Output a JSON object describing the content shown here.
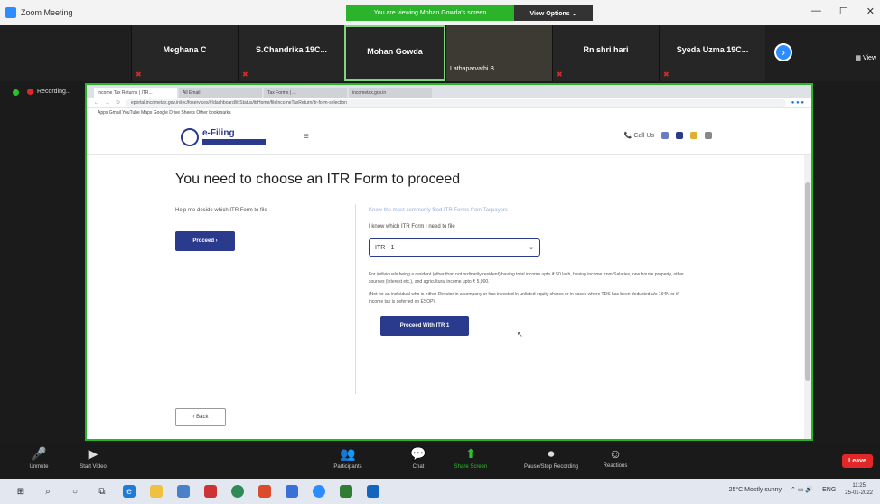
{
  "zoom": {
    "title": "Zoom Meeting",
    "viewing_banner": "You are viewing Mohan Gowda's screen",
    "view_options": "View Options ⌄",
    "side_view": "▦ View"
  },
  "participants": [
    {
      "name": "Meghana C"
    },
    {
      "name": "S.Chandrika 19C..."
    },
    {
      "name": "Mohan Gowda"
    },
    {
      "name": "Lathaparvathi B..."
    },
    {
      "name": "Rn shri hari"
    },
    {
      "name": "Syeda Uzma 19C..."
    }
  ],
  "recording": {
    "label": "Recording..."
  },
  "browser": {
    "tabs": [
      {
        "label": "Income Tax Returns | ITR..."
      },
      {
        "label": "All Email"
      },
      {
        "label": "Tax Forms | ..."
      },
      {
        "label": "incometax.gov.in"
      }
    ],
    "url": "eportal.incometax.gov.in/iec/foservices/#/dashboard/itrStatus/itrHome/fileIncomeTaxReturn/itr-form-selection",
    "bookmarks": "Apps   Gmail   YouTube   Maps   Google   Drive   Sheets   Other bookmarks"
  },
  "site": {
    "logo_text": "e-Filing",
    "call_us": "📞 Call Us",
    "page_title": "You need to choose an ITR Form to proceed",
    "help_text": "Help me decide which ITR Form to file",
    "proceed_label": "Proceed ›",
    "link_text": "Know the most commonly filed ITR Forms from Taxpayers",
    "question": "I know which ITR Form I need to file",
    "selected_form": "ITR - 1",
    "desc_1": "For individuals being a resident (other than not ordinarily resident) having total income upto ₹ 50 lakh, having income from Salaries, one house property, other sources (interest etc.), and agricultural income upto ₹ 5,000.",
    "desc_2": "(Not for an individual who is either Director in a company or has invested in unlisted equity shares or in cases where TDS has been deducted u/s 194N or if income tax is deferred on ESOP)",
    "proceed_itr_label": "Proceed With ITR 1",
    "back_label": "‹ Back"
  },
  "controls": [
    {
      "icon": "🎤",
      "label": "Unmute"
    },
    {
      "icon": "▶",
      "label": "Start Video"
    },
    {
      "icon": "👥",
      "label": "Participants"
    },
    {
      "icon": "💬",
      "label": "Chat"
    },
    {
      "icon": "⬆",
      "label": "Share Screen"
    },
    {
      "icon": "⏺",
      "label": "Pause/Stop Recording"
    },
    {
      "icon": "☺",
      "label": "Reactions"
    }
  ],
  "leave_label": "Leave",
  "taskbar": {
    "weather": "25°C  Mostly sunny",
    "time": "11:25",
    "date": "25-01-2022",
    "lang": "ENG"
  }
}
